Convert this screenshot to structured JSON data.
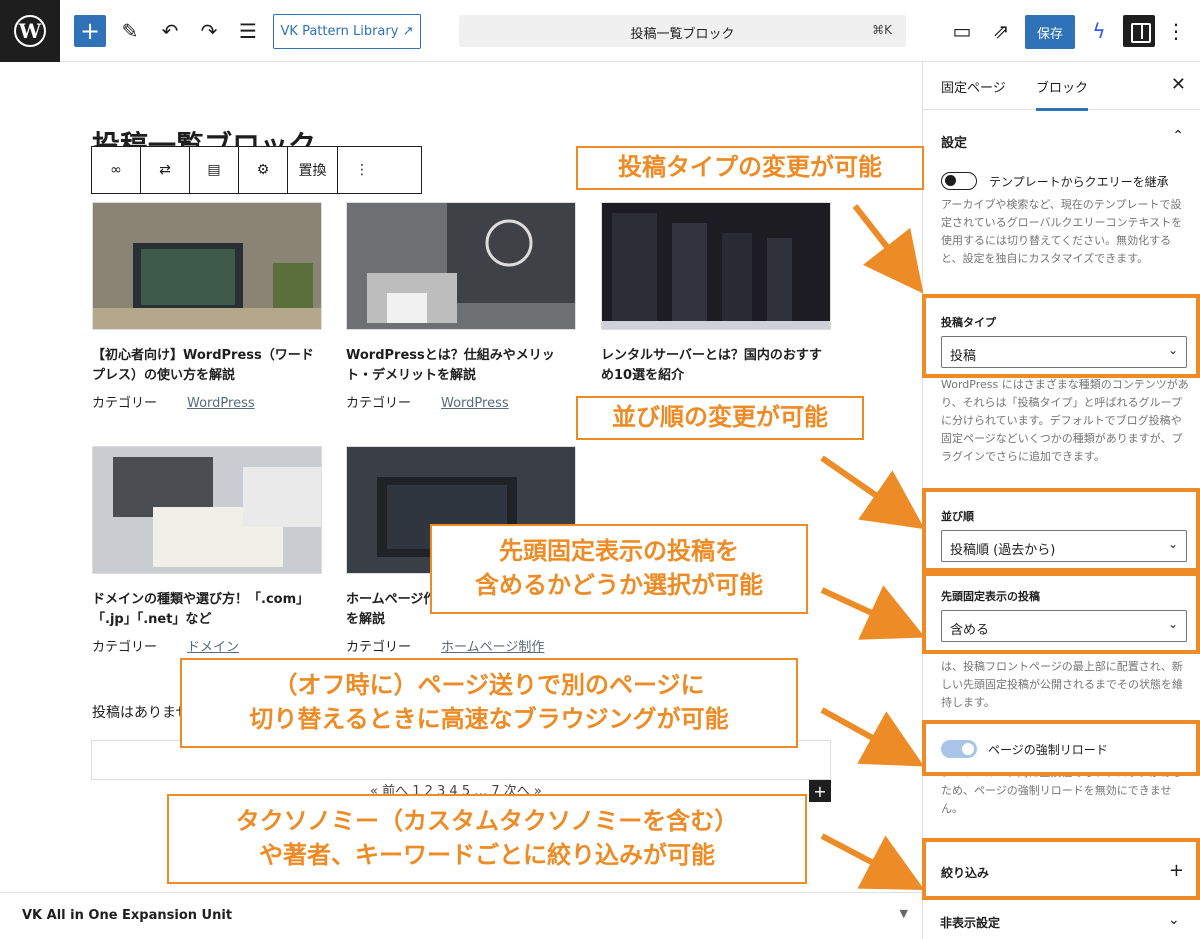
{
  "header": {
    "vk_library": "VK Pattern Library ↗",
    "command_title": "投稿一覧ブロック",
    "command_shortcut": "⌘K",
    "save": "保存"
  },
  "editor": {
    "page_title": "投稿一覧ブロック",
    "toolbar_replace": "置換",
    "posts": [
      {
        "title": "【初心者向け】WordPress（ワードプレス）の使い方を解説",
        "category_label": "カテゴリー",
        "category": "WordPress"
      },
      {
        "title": "WordPressとは？仕組みやメリット・デメリットを解説",
        "category_label": "カテゴリー",
        "category": "WordPress"
      },
      {
        "title": "レンタルサーバーとは？国内のおすすめ10選を紹介",
        "category_label": "",
        "category": ""
      },
      {
        "title": "ドメインの種類や選び方！「.com」「.jp」「.net」など",
        "category_label": "カテゴリー",
        "category": "ドメイン"
      },
      {
        "title": "ホームページ作成の方法や運用コストを解説",
        "category_label": "カテゴリー",
        "category": "ホームページ制作"
      }
    ],
    "no_posts": "投稿はありません。",
    "pager": "« 前へ 1 2 3 4 5 … 7 次へ »",
    "footer_panel": "VK All in One Expansion Unit"
  },
  "sidebar": {
    "tab_page": "固定ページ",
    "tab_block": "ブロック",
    "settings_heading": "設定",
    "inherit_label": "テンプレートからクエリーを継承",
    "inherit_help": "アーカイブや検索など、現在のテンプレートで設定されているグローバルクエリーコンテキストを使用するには切り替えてください。無効化すると、設定を独自にカスタマイズできます。",
    "post_type_label": "投稿タイプ",
    "post_type_value": "投稿",
    "post_type_help": "WordPress にはさまざまな種類のコンテンツがあり、それらは「投稿タイプ」と呼ばれるグループに分けられています。デフォルトでブログ投稿や固定ページなどいくつかの種類がありますが、プラグインでさらに追加できます。",
    "order_label": "並び順",
    "order_value": "投稿順 (過去から)",
    "sticky_label": "先頭固定表示の投稿",
    "sticky_value": "含める",
    "sticky_help": "ブログ記事は先頭に固定表示できます。この機能は、投稿フロントページの最上部に配置され、新しい先頭固定投稿が公開されるまでその状態を維持します。",
    "reload_label": "ページの強制リロード",
    "reload_help": "クエリーループ内に互換性のないブロックがあるため、ページの強制リロードを無効にできません。",
    "filter_label": "絞り込み",
    "hidden_label": "非表示設定"
  },
  "callouts": {
    "post_type": "投稿タイプの変更が可能",
    "order": "並び順の変更が可能",
    "sticky_1": "先頭固定表示の投稿を",
    "sticky_2": "含めるかどうか選択が可能",
    "reload_1": "（オフ時に）ページ送りで別のページに",
    "reload_2": "切り替えるときに高速なブラウジングが可能",
    "filter_1": "タクソノミー（カスタムタクソノミーを含む）",
    "filter_2": "や著者、キーワードごとに絞り込みが可能"
  },
  "colors": {
    "accent": "#ed8c26",
    "primary": "#2f72b8"
  }
}
